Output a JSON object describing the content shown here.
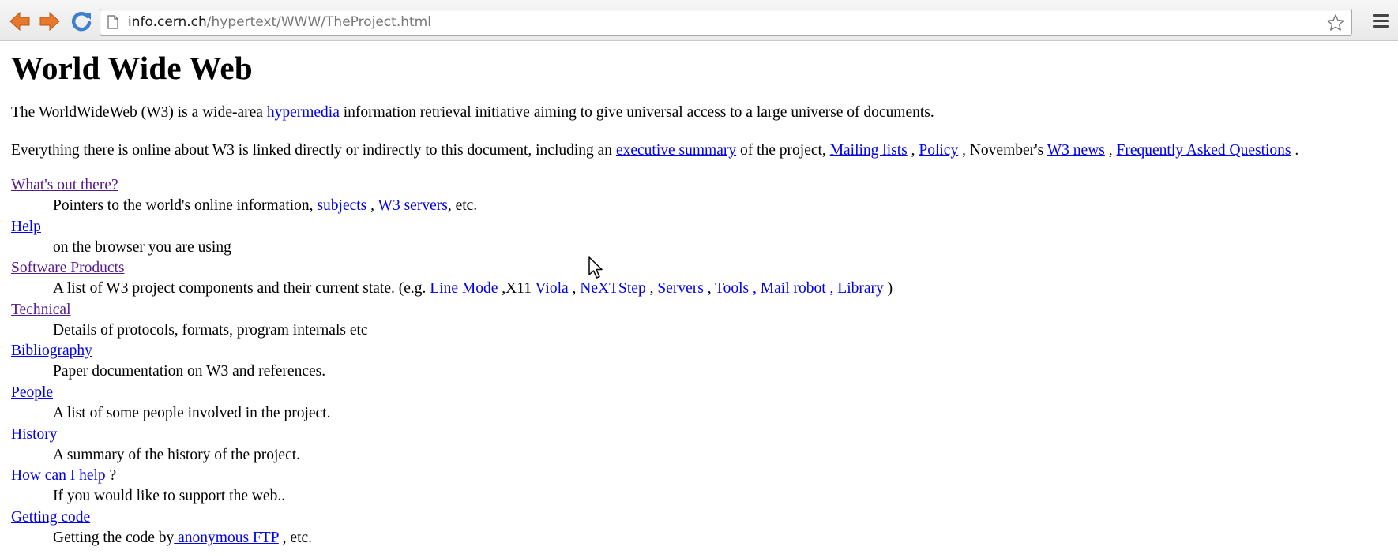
{
  "browser": {
    "url_host": "info.cern.ch",
    "url_path": "/hypertext/WWW/TheProject.html"
  },
  "page": {
    "title": "World Wide Web",
    "intro": {
      "before": "The WorldWideWeb (W3) is a wide-area",
      "link_hypermedia": " hypermedia",
      "after": " information retrieval initiative aiming to give universal access to a large universe of documents."
    },
    "everything": {
      "before": "Everything there is online about W3 is linked directly or indirectly to this document, including an ",
      "link_exec_summary": "executive summary",
      "t1": " of the project, ",
      "link_mailing_lists": "Mailing lists",
      "t2": " , ",
      "link_policy": "Policy",
      "t3": " , November's ",
      "link_w3_news": "W3 news",
      "t4": " , ",
      "link_faq": "Frequently Asked Questions",
      "t5": " ."
    },
    "items": {
      "whats_out": {
        "term": "What's out there?",
        "d_before": "Pointers to the world's online information,",
        "link_subjects": " subjects",
        "d_mid": " , ",
        "link_w3_servers": "W3 servers",
        "d_after": ", etc."
      },
      "help": {
        "term": "Help",
        "desc": "on the browser you are using"
      },
      "software": {
        "term": "Software Products",
        "d_before": "A list of W3 project components and their current state. (e.g. ",
        "link_line_mode": "Line Mode",
        "d_x11": " ,X11 ",
        "link_viola": "Viola",
        "sep1": " , ",
        "link_nextstep": "NeXTStep",
        "sep2": " , ",
        "link_servers": "Servers",
        "sep3": " , ",
        "link_tools": "Tools",
        "sep4": " ",
        "link_mail_robot": ", Mail robot",
        "sep5": " ",
        "link_library": ", Library",
        "d_after": " )"
      },
      "technical": {
        "term": "Technical",
        "desc": "Details of protocols, formats, program internals etc"
      },
      "bibliography": {
        "term": "Bibliography",
        "desc": "Paper documentation on W3 and references."
      },
      "people": {
        "term": "People",
        "desc": "A list of some people involved in the project."
      },
      "history": {
        "term": "History",
        "desc": "A summary of the history of the project."
      },
      "how_help": {
        "term": "How can I help",
        "term_suffix": " ?",
        "desc": "If you would like to support the web.."
      },
      "getting_code": {
        "term": "Getting code",
        "d_before": "Getting the code by",
        "link_ftp": " anonymous FTP",
        "d_after": " , etc."
      }
    }
  },
  "icons": {
    "back": "back-arrow-icon",
    "forward": "forward-arrow-icon",
    "reload": "reload-icon",
    "page": "page-icon",
    "star": "star-icon",
    "menu": "menu-icon",
    "cursor": "mouse-cursor-icon"
  },
  "colors": {
    "link": "#0000ee",
    "visited_link": "#551a8b",
    "nav_arrow": "#e8782c",
    "reload": "#3f7fd0"
  }
}
